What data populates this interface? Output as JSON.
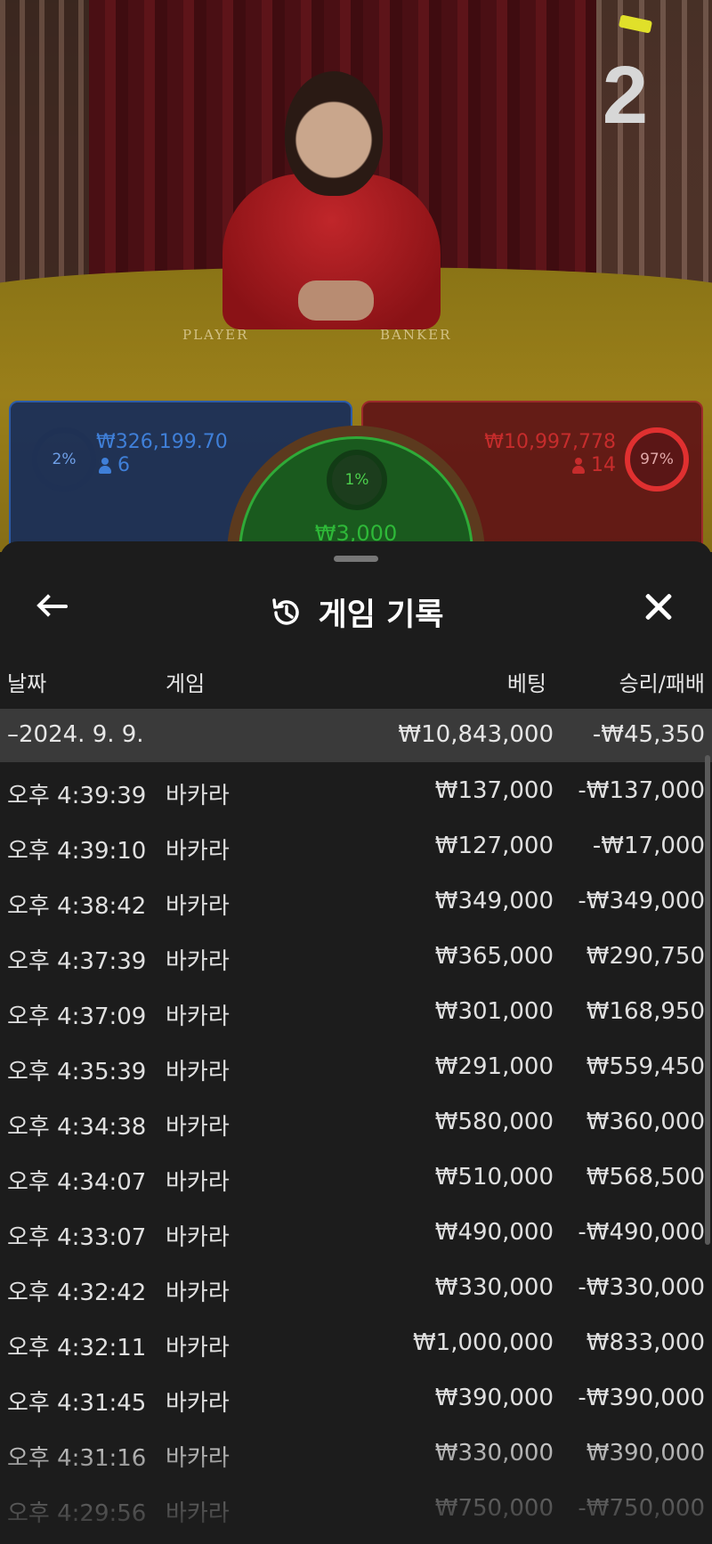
{
  "video": {
    "round_number": "2",
    "felt_player_label": "PLAYER",
    "felt_banker_label": "BANKER"
  },
  "bets": {
    "player": {
      "percent": "2%",
      "amount": "₩326,199.70",
      "players": "6",
      "color": "#2c5ba8"
    },
    "tie": {
      "percent": "1%",
      "amount": "₩3,000",
      "color": "#2faa38"
    },
    "banker": {
      "percent": "97%",
      "amount": "₩10,997,778",
      "players": "14",
      "color": "#c62c2c"
    }
  },
  "sheet": {
    "title": "게임 기록",
    "icons": {
      "back": "arrow-left-icon",
      "history": "history-icon",
      "close": "close-icon"
    },
    "columns": {
      "date": "날짜",
      "game": "게임",
      "bet": "베팅",
      "result": "승리/패배"
    },
    "day_summary": {
      "date": "–2024. 9. 9.",
      "bet": "₩10,843,000",
      "result": "-₩45,350"
    },
    "rows": [
      {
        "time": "오후 4:39:39",
        "game": "바카라",
        "bet": "₩137,000",
        "result": "-₩137,000"
      },
      {
        "time": "오후 4:39:10",
        "game": "바카라",
        "bet": "₩127,000",
        "result": "-₩17,000"
      },
      {
        "time": "오후 4:38:42",
        "game": "바카라",
        "bet": "₩349,000",
        "result": "-₩349,000"
      },
      {
        "time": "오후 4:37:39",
        "game": "바카라",
        "bet": "₩365,000",
        "result": "₩290,750"
      },
      {
        "time": "오후 4:37:09",
        "game": "바카라",
        "bet": "₩301,000",
        "result": "₩168,950"
      },
      {
        "time": "오후 4:35:39",
        "game": "바카라",
        "bet": "₩291,000",
        "result": "₩559,450"
      },
      {
        "time": "오후 4:34:38",
        "game": "바카라",
        "bet": "₩580,000",
        "result": "₩360,000"
      },
      {
        "time": "오후 4:34:07",
        "game": "바카라",
        "bet": "₩510,000",
        "result": "₩568,500"
      },
      {
        "time": "오후 4:33:07",
        "game": "바카라",
        "bet": "₩490,000",
        "result": "-₩490,000"
      },
      {
        "time": "오후 4:32:42",
        "game": "바카라",
        "bet": "₩330,000",
        "result": "-₩330,000"
      },
      {
        "time": "오후 4:32:11",
        "game": "바카라",
        "bet": "₩1,000,000",
        "result": "₩833,000"
      },
      {
        "time": "오후 4:31:45",
        "game": "바카라",
        "bet": "₩390,000",
        "result": "-₩390,000"
      },
      {
        "time": "오후 4:31:16",
        "game": "바카라",
        "bet": "₩330,000",
        "result": "₩390,000"
      },
      {
        "time": "오후 4:29:56",
        "game": "바카라",
        "bet": "₩750,000",
        "result": "-₩750,000"
      }
    ]
  }
}
